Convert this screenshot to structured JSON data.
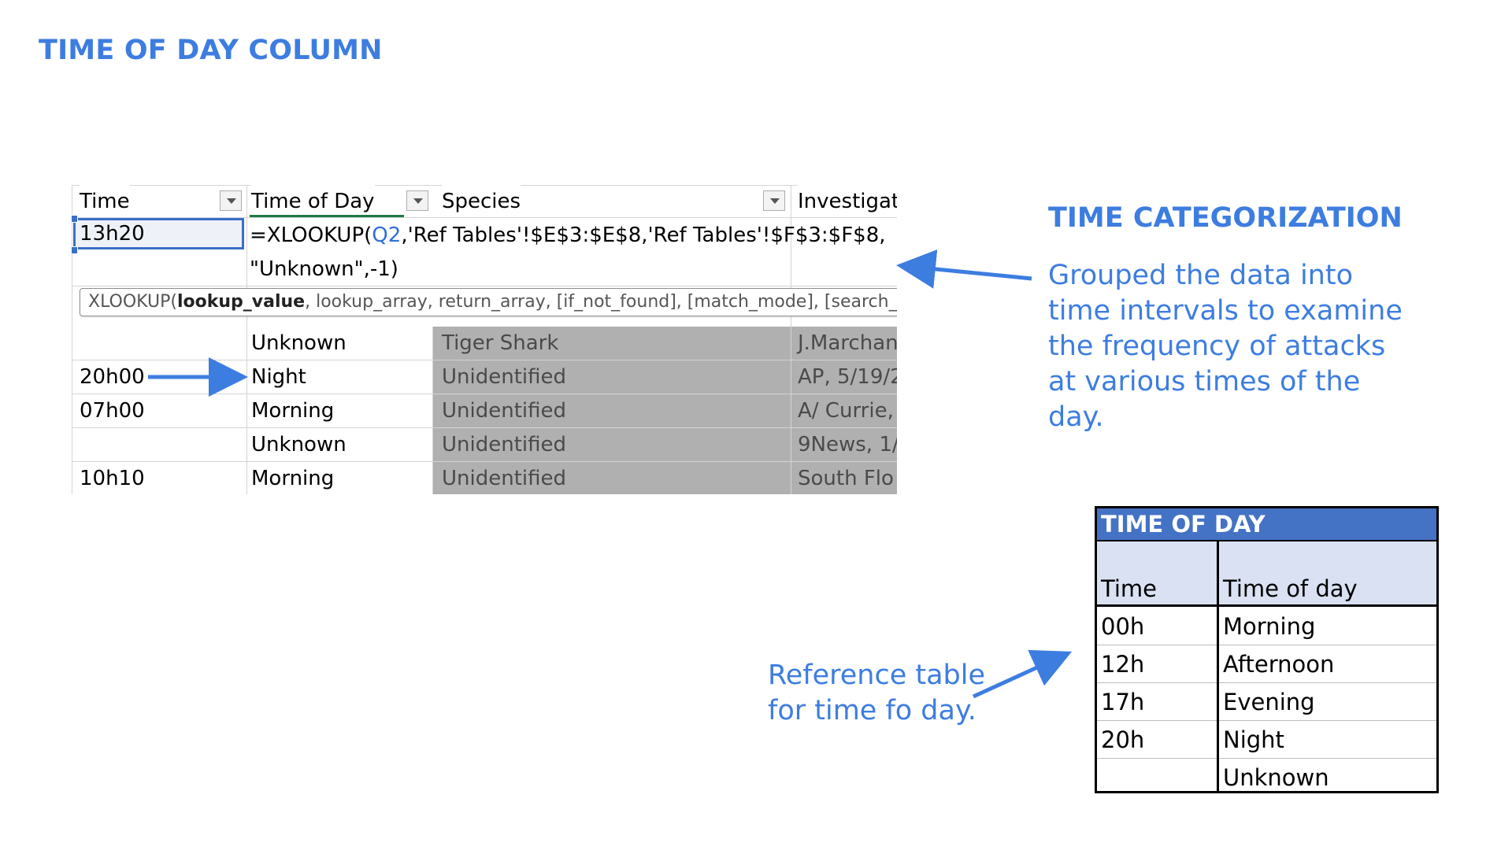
{
  "slide": {
    "title": "TIME OF DAY COLUMN",
    "accent_color": "#3d7de0"
  },
  "sheet": {
    "headers": [
      "Time",
      "Time of Day",
      "Species",
      "Investigat"
    ],
    "active_cell_value": "13h20",
    "formula": {
      "line1_prefix": "=XLOOKUP(",
      "line1_ref": "Q2",
      "line1_suffix": ",'Ref Tables'!$E$3:$E$8,'Ref Tables'!$F$3:$F$8,",
      "line2": "\"Unknown\",-1)"
    },
    "tooltip": {
      "fn": "XLOOKUP(",
      "bold_arg": "lookup_value",
      "rest": ", lookup_array, return_array, [if_not_found], [match_mode], [search_mode])"
    },
    "rows": [
      {
        "time": "",
        "tod": "Unknown",
        "species": "Tiger Shark",
        "inv": "J.Marchand"
      },
      {
        "time": "20h00",
        "tod": "Night",
        "species": "Unidentified",
        "inv": "AP, 5/19/2"
      },
      {
        "time": "07h00",
        "tod": "Morning",
        "species": "Unidentified",
        "inv": "A/ Currie,"
      },
      {
        "time": "",
        "tod": "Unknown",
        "species": "Unidentified",
        "inv": "9News, 1/"
      },
      {
        "time": "10h10",
        "tod": "Morning",
        "species": "Unidentified",
        "inv": "South Flo"
      }
    ]
  },
  "annotations": {
    "categorization_title": "TIME CATEGORIZATION",
    "categorization_text": "Grouped the data into time intervals to examine the frequency of attacks at various times of the day.",
    "reference_note": "Reference table for time fo day."
  },
  "reftable": {
    "title": "TIME OF DAY",
    "col_time": "Time",
    "col_tod": "Time of day",
    "rows": [
      {
        "time": "00h",
        "tod": "Morning"
      },
      {
        "time": "12h",
        "tod": "Afternoon"
      },
      {
        "time": "17h",
        "tod": "Evening"
      },
      {
        "time": "20h",
        "tod": "Night"
      },
      {
        "time": "",
        "tod": "Unknown"
      }
    ],
    "header_color": "#4472c4",
    "subheader_color": "#d9e1f2"
  }
}
